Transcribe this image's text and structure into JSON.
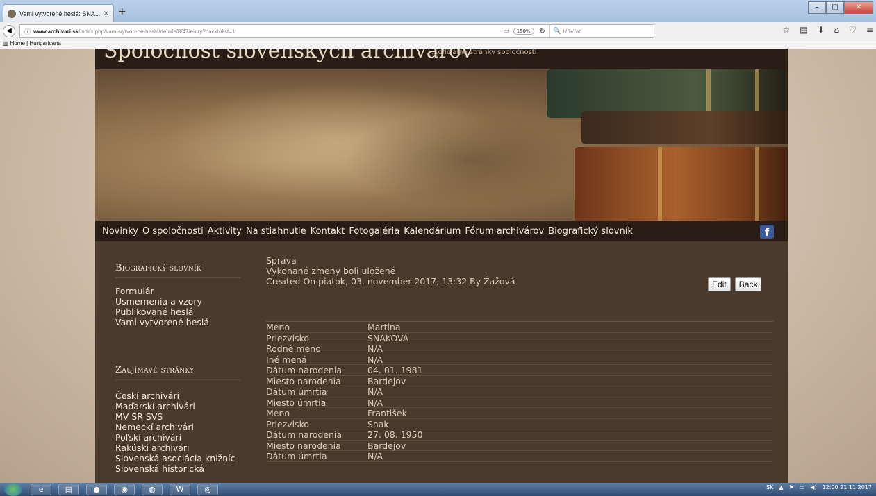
{
  "browser": {
    "tab_title": "Vami vytvorené heslá: SNA...",
    "tab_close": "×",
    "new_tab": "+",
    "url_host": "www.archivari.sk",
    "url_path": "/index.php/vami-vytvorene-hesla/details/8/47/entry?backtolist=1",
    "zoom": "150%",
    "search_placeholder": "Hľadať",
    "bookmark": "Home | Hungaricana"
  },
  "site": {
    "title": "Spoločnosť slovenských archivárov",
    "motto": "...oficiálne stránky spoločnosti",
    "menu": [
      "Novinky",
      "O spoločnosti",
      "Aktivity",
      "Na stiahnutie",
      "Kontakt",
      "Fotogaléria",
      "Kalendárium",
      "Fórum archivárov",
      "Biografický slovník"
    ],
    "facebook_letter": "f"
  },
  "sidebar": {
    "heading1": "Biografický slovník",
    "links1": [
      "Formulár",
      "Usmernenia a vzory",
      "Publikované heslá",
      "Vami vytvorené heslá"
    ],
    "heading2": "Zaujímavé stránky",
    "links2": [
      "Českí archivári",
      "Maďarskí archivári",
      "MV SR SVS",
      "Nemeckí archivári",
      "Poľskí archivári",
      "Rakúski archivári",
      "Slovenská asociácia knižníc",
      "Slovenská historická"
    ]
  },
  "main": {
    "msg_title": "Správa",
    "msg_text": "Vykonané zmeny boli uložené",
    "created": "Created On piatok, 03. november 2017, 13:32 By Žažová",
    "edit_label": "Edit",
    "back_label": "Back",
    "rows": [
      {
        "label": "Meno",
        "value": "Martina"
      },
      {
        "label": "Priezvisko",
        "value": "SNAKOVÁ"
      },
      {
        "label": "Rodné meno",
        "value": "N/A"
      },
      {
        "label": "Iné mená",
        "value": "N/A"
      },
      {
        "label": "Dátum narodenia",
        "value": "04. 01. 1981"
      },
      {
        "label": "Miesto narodenia",
        "value": "Bardejov"
      },
      {
        "label": "Dátum úmrtia",
        "value": "N/A"
      },
      {
        "label": "Miesto úmrtia",
        "value": "N/A"
      },
      {
        "label": "Meno",
        "value": "František"
      },
      {
        "label": "Priezvisko",
        "value": "Snak"
      },
      {
        "label": "Dátum narodenia",
        "value": "27. 08. 1950"
      },
      {
        "label": "Miesto narodenia",
        "value": "Bardejov"
      },
      {
        "label": "Dátum úmrtia",
        "value": "N/A"
      }
    ]
  },
  "taskbar": {
    "lang": "SK",
    "time": "12:00",
    "date": "21.11.2017"
  }
}
